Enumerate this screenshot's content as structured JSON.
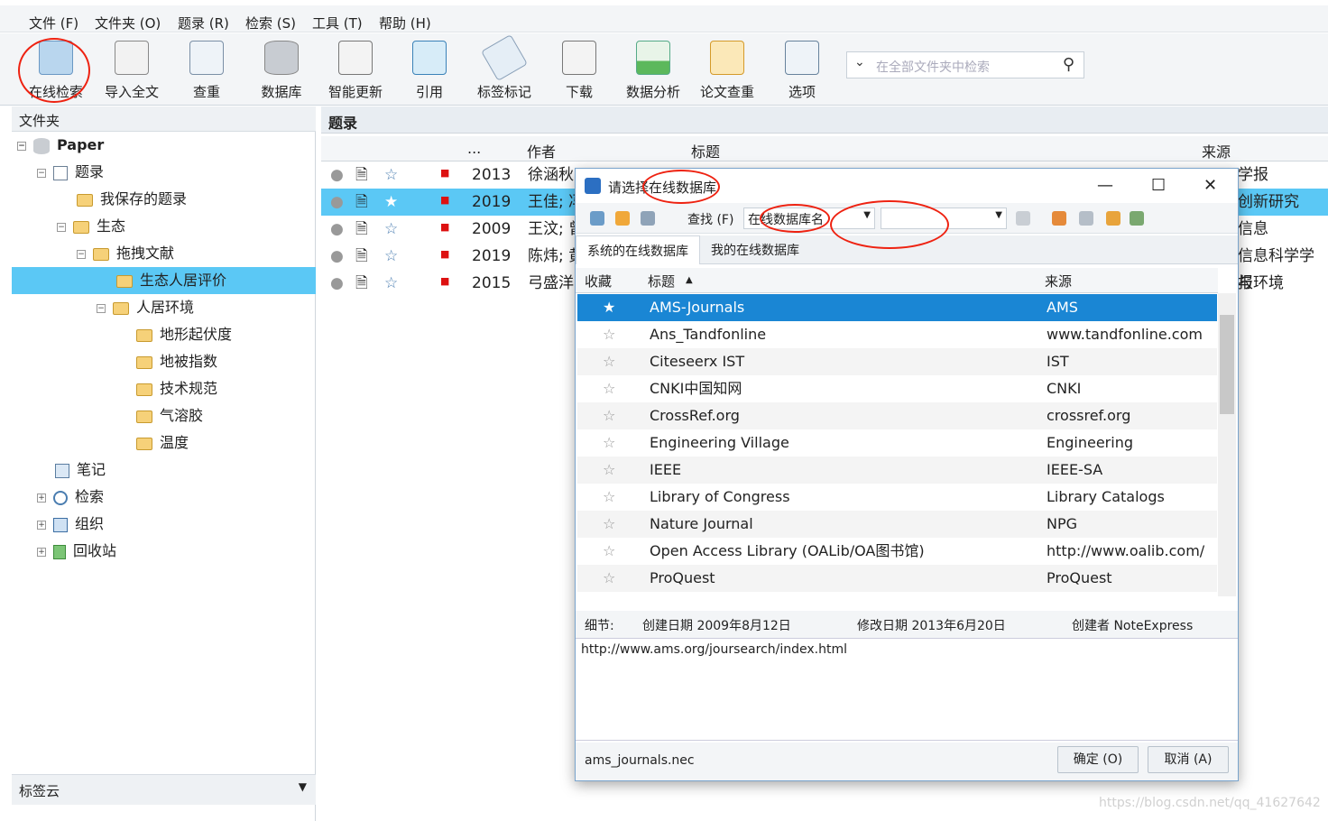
{
  "menu": [
    "文件 (F)",
    "文件夹 (O)",
    "题录 (R)",
    "检索 (S)",
    "工具 (T)",
    "帮助 (H)"
  ],
  "toolbar": {
    "buttons": [
      "在线检索",
      "导入全文",
      "查重",
      "数据库",
      "智能更新",
      "引用",
      "标签标记",
      "下载",
      "数据分析",
      "论文查重",
      "选项"
    ],
    "search_placeholder": "在全部文件夹中检索"
  },
  "left": {
    "header": "文件夹",
    "tree": [
      "Paper",
      "题录",
      "我保存的题录",
      "生态",
      "拖拽文献",
      "生态人居评价",
      "人居环境",
      "地形起伏度",
      "地被指数",
      "技术规范",
      "气溶胶",
      "温度",
      "笔记",
      "检索",
      "组织",
      "回收站"
    ],
    "footer": "标签云"
  },
  "right": {
    "header": "题录",
    "columns": [
      "...",
      "作者",
      "标题",
      "来源"
    ],
    "rows": [
      {
        "year": "2013",
        "author": "徐涵秋",
        "source": "学报"
      },
      {
        "year": "2019",
        "author": "王佳; 冯",
        "source": "创新研究"
      },
      {
        "year": "2009",
        "author": "王汶; 曾",
        "source": "信息"
      },
      {
        "year": "2019",
        "author": "陈炜; 黄",
        "source": "信息科学学报"
      },
      {
        "year": "2015",
        "author": "弓盛洋",
        "source": "与环境"
      }
    ]
  },
  "dialog": {
    "title": "请选择在线数据库",
    "find_label": "查找 (F)",
    "combo1": "在线数据库名",
    "combo2": "",
    "tabs": [
      "系统的在线数据库",
      "我的在线数据库"
    ],
    "table_headers": [
      "收藏",
      "标题",
      "来源"
    ],
    "rows": [
      {
        "title": "AMS-Journals",
        "source": "AMS"
      },
      {
        "title": "Ans_Tandfonline",
        "source": "www.tandfonline.com"
      },
      {
        "title": "Citeseerx IST",
        "source": "IST"
      },
      {
        "title": "CNKI中国知网",
        "source": "CNKI"
      },
      {
        "title": "CrossRef.org",
        "source": "crossref.org"
      },
      {
        "title": "Engineering Village",
        "source": "Engineering"
      },
      {
        "title": "IEEE",
        "source": "IEEE-SA"
      },
      {
        "title": "Library of Congress",
        "source": "Library Catalogs"
      },
      {
        "title": "Nature Journal",
        "source": "NPG"
      },
      {
        "title": "Open Access Library (OALib/OA图书馆)",
        "source": "http://www.oalib.com/"
      },
      {
        "title": "ProQuest",
        "source": "ProQuest"
      }
    ],
    "details_label": "细节:",
    "created": "创建日期  2009年8月12日",
    "modified": "修改日期  2013年6月20日",
    "creator": "创建者  NoteExpress",
    "url": "http://www.ams.org/joursearch/index.html",
    "filename": "ams_journals.nec",
    "ok": "确定 (O)",
    "cancel": "取消 (A)"
  },
  "watermark": "https://blog.csdn.net/qq_41627642",
  "colors": {
    "selection": "#5bc8f5",
    "dialog_selection": "#1a86d4",
    "annotation": "#e21"
  }
}
